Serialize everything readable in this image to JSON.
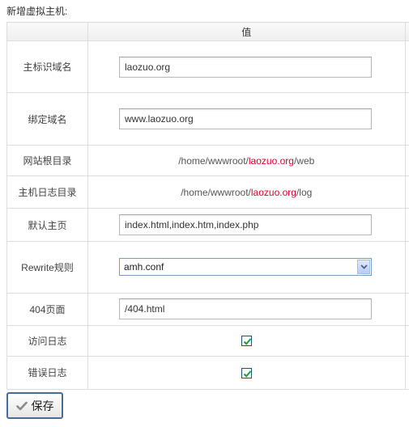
{
  "page": {
    "title": "新增虚拟主机:"
  },
  "table": {
    "header": {
      "label_col": "",
      "value_col": "值"
    },
    "rows": {
      "main_domain": {
        "label": "主标识域名",
        "value": "laozuo.org"
      },
      "bind_domain": {
        "label": "绑定域名",
        "value": "www.laozuo.org"
      },
      "web_root": {
        "label": "网站根目录",
        "prefix": "/home/wwwroot/",
        "highlight": "laozuo.org",
        "suffix": "/web"
      },
      "log_dir": {
        "label": "主机日志目录",
        "prefix": "/home/wwwroot/",
        "highlight": "laozuo.org",
        "suffix": "/log"
      },
      "default_page": {
        "label": "默认主页",
        "value": "index.html,index.htm,index.php"
      },
      "rewrite": {
        "label": "Rewrite规则",
        "selected": "amh.conf"
      },
      "error_page": {
        "label": "404页面",
        "value": "/404.html"
      },
      "access_log": {
        "label": "访问日志",
        "checked": true
      },
      "error_log": {
        "label": "错误日志",
        "checked": true
      }
    }
  },
  "actions": {
    "save_label": "保存"
  },
  "colors": {
    "highlight": "#e0002a",
    "border": "#dddddd",
    "checkbox_tick": "#1f9a2c"
  }
}
